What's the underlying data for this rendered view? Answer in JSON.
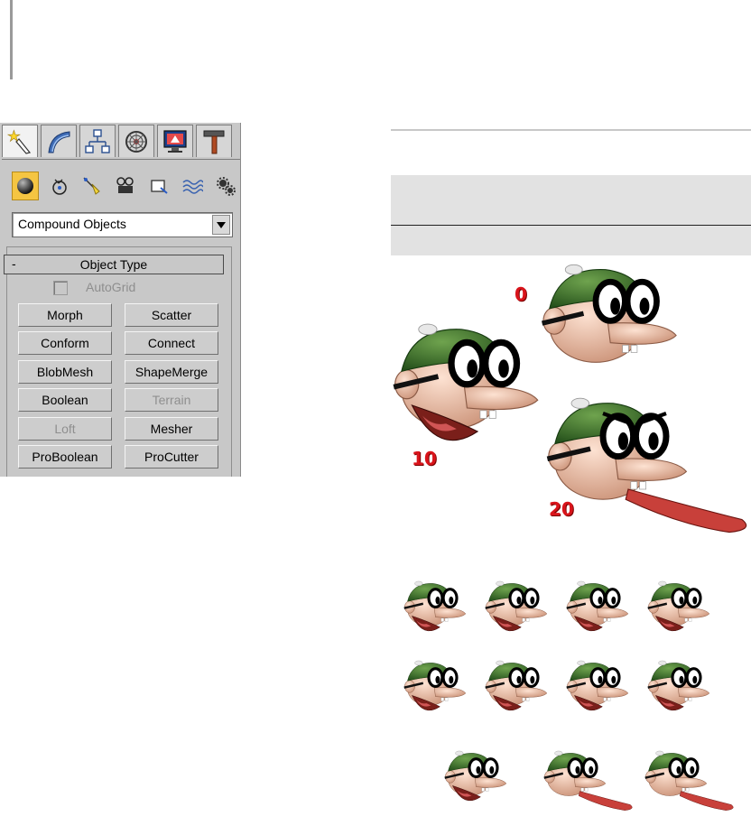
{
  "panel": {
    "tabs": [
      {
        "name": "create",
        "icon": "create-wand-icon",
        "active": true
      },
      {
        "name": "modify",
        "icon": "modify-arc-icon",
        "active": false
      },
      {
        "name": "hierarchy",
        "icon": "hierarchy-icon",
        "active": false
      },
      {
        "name": "motion",
        "icon": "motion-wheel-icon",
        "active": false
      },
      {
        "name": "display",
        "icon": "display-monitor-icon",
        "active": false
      },
      {
        "name": "utilities",
        "icon": "utilities-hammer-icon",
        "active": false
      }
    ],
    "categories": [
      {
        "name": "geometry",
        "icon": "sphere-icon",
        "active": true
      },
      {
        "name": "shapes",
        "icon": "shapes-icon"
      },
      {
        "name": "lights",
        "icon": "light-icon"
      },
      {
        "name": "cameras",
        "icon": "camera-icon"
      },
      {
        "name": "helpers",
        "icon": "helper-icon"
      },
      {
        "name": "space-warps",
        "icon": "spacewarp-icon"
      },
      {
        "name": "systems",
        "icon": "systems-gear-icon"
      }
    ],
    "dropdown": {
      "value": "Compound Objects"
    },
    "rollout": {
      "toggle": "-",
      "title": "Object Type",
      "autogrid_label": "AutoGrid"
    },
    "buttons": [
      {
        "label": "Morph",
        "enabled": true
      },
      {
        "label": "Scatter",
        "enabled": true
      },
      {
        "label": "Conform",
        "enabled": true
      },
      {
        "label": "Connect",
        "enabled": true
      },
      {
        "label": "BlobMesh",
        "enabled": true
      },
      {
        "label": "ShapeMerge",
        "enabled": true
      },
      {
        "label": "Boolean",
        "enabled": true
      },
      {
        "label": "Terrain",
        "enabled": false
      },
      {
        "label": "Loft",
        "enabled": false
      },
      {
        "label": "Mesher",
        "enabled": true
      },
      {
        "label": "ProBoolean",
        "enabled": true
      },
      {
        "label": "ProCutter",
        "enabled": true
      }
    ]
  },
  "morph_frames": {
    "labels": [
      "0",
      "10",
      "20"
    ]
  },
  "colors": {
    "active_category": "#f5c542",
    "frame_label": "#d9141b",
    "cap": "#3f7a2b",
    "skin": "#f1c2a8",
    "tongue": "#c8403a"
  }
}
